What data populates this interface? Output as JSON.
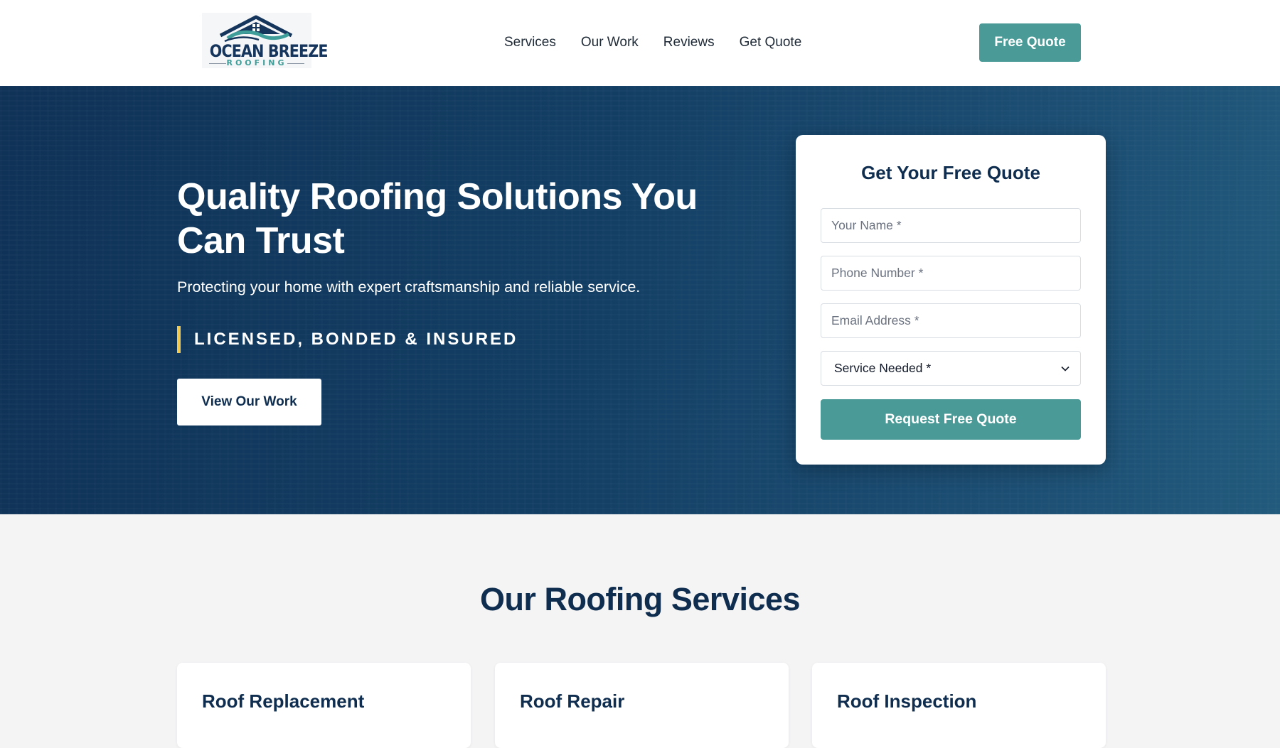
{
  "brand": {
    "name": "OCEAN BREEZE",
    "tagline": "ROOFING"
  },
  "nav": {
    "items": [
      "Services",
      "Our Work",
      "Reviews",
      "Get Quote"
    ]
  },
  "header": {
    "cta_label": "Free Quote"
  },
  "hero": {
    "title": "Quality Roofing Solutions You Can Trust",
    "subtitle": "Protecting your home with expert craftsmanship and reliable service.",
    "badge": "LICENSED, BONDED & INSURED",
    "button_label": "View Our Work"
  },
  "quote_form": {
    "title": "Get Your Free Quote",
    "name_placeholder": "Your Name *",
    "phone_placeholder": "Phone Number *",
    "email_placeholder": "Email Address *",
    "service_selected": "Service Needed *",
    "submit_label": "Request Free Quote"
  },
  "services": {
    "title": "Our Roofing Services",
    "cards": [
      {
        "title": "Roof Replacement"
      },
      {
        "title": "Roof Repair"
      },
      {
        "title": "Roof Inspection"
      }
    ]
  },
  "colors": {
    "accent_teal": "#4a9b98",
    "navy": "#0f2d4f",
    "hero_bg": "#133e64",
    "badge_bar": "#f2c94c"
  },
  "icons": {
    "logo": "house-roof-wave-icon",
    "select_chevron": "chevron-down-icon"
  }
}
